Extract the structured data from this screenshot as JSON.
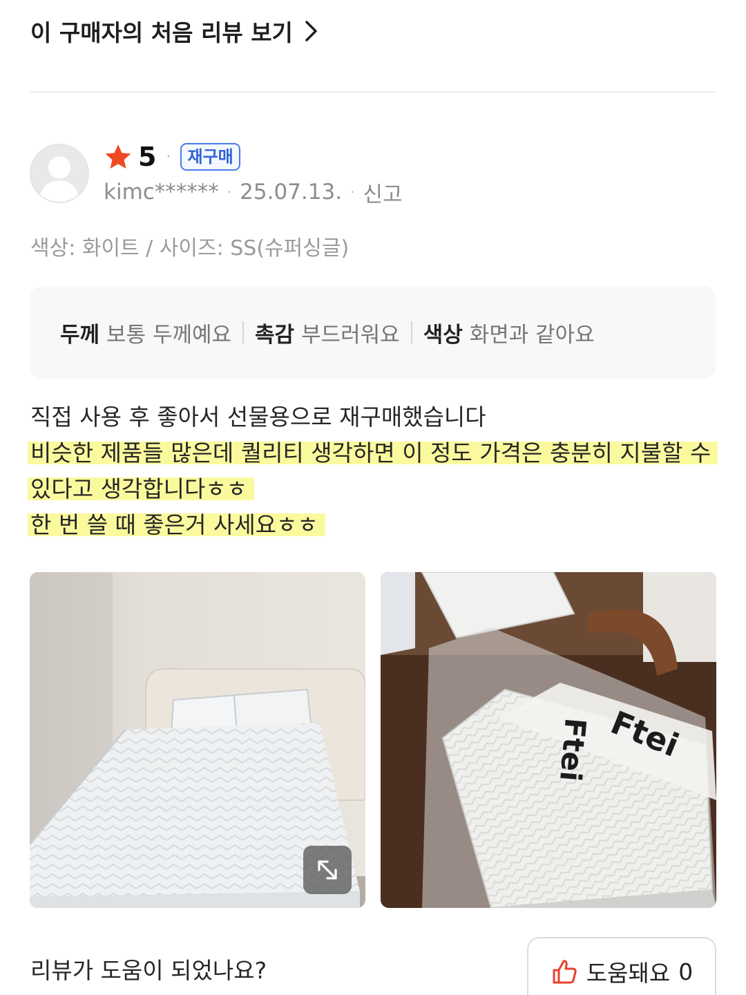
{
  "header": {
    "first_review_link": "이 구매자의 처음 리뷰 보기"
  },
  "review": {
    "rating": "5",
    "badge": "재구매",
    "reviewer": "kimc******",
    "date": "25.07.13.",
    "report": "신고",
    "option": "색상: 화이트 / 사이즈: SS(슈퍼싱글)",
    "attributes": [
      {
        "key": "두께",
        "value": "보통 두께예요"
      },
      {
        "key": "촉감",
        "value": "부드러워요"
      },
      {
        "key": "색상",
        "value": "화면과 같아요"
      }
    ],
    "body_lines": [
      "직접 사용 후 좋아서 선물용으로 재구매했습니다",
      "비슷한 제품들 많은데 퀄리티 생각하면 이 정도 가격은 충분히 지불할 수",
      "있다고 생각합니다ㅎㅎ",
      "한 번 쓸 때 좋은거 사세요ㅎㅎ"
    ],
    "photo_2_brand": "Ftei"
  },
  "helpful": {
    "question": "리뷰가 도움이 되었나요?",
    "button_label": "도움돼요",
    "count": "0"
  },
  "colors": {
    "star": "#f04a23",
    "badge_blue": "#2f62d8",
    "highlight": "#faf88c",
    "thumb": "#e8402a"
  },
  "icons": [
    "chevron-right-icon",
    "star-icon",
    "avatar-placeholder-icon",
    "expand-icon",
    "thumbs-up-icon"
  ]
}
